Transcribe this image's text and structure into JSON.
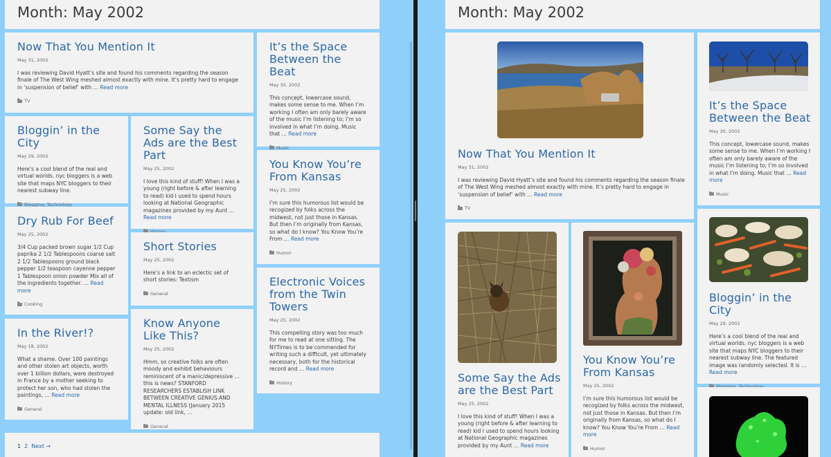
{
  "archive_title": "Month: May 2002",
  "read_more": "Read more",
  "left": {
    "posts": [
      {
        "title": "Now That You Mention It",
        "date": "May 31, 2002",
        "excerpt": "I was reviewing David Hyatt’s site and found his comments regarding the season finale of The West Wing meshed almost exactly with mine. It’s pretty hard to engage in ‘suspension of belief’ with …",
        "category": "TV"
      },
      {
        "title": "It’s the Space Between the Beat",
        "date": "May 30, 2002",
        "excerpt": "This concept, lowercase sound, makes some sense to me. When I’m working I often am only barely aware of the music I’m listening to; I’m so involved in what I’m doing. Music that …",
        "category": "Music"
      },
      {
        "title": "Bloggin’ in the City",
        "date": "May 29, 2002",
        "excerpt": "Here’s a cool blend of the real and virtual worlds. nyc bloggers is a web site that maps NYC bloggers to their nearest subway line.",
        "category": "Blogging, Technology"
      },
      {
        "title": "Some Say the Ads are the Best Part",
        "date": "May 25, 2002",
        "excerpt": "I love this kind of stuff! When I was a young (right before & after learning to read) kid I used to spend hours looking at National Geographic magazines provided by my Aunt …",
        "category": "History"
      },
      {
        "title": "You Know You’re From Kansas",
        "date": "May 25, 2002",
        "excerpt": "I’m sure this humorous list would be recogized by folks across the midwest, not just those in Kansas. But then I’m originally from Kansas, so what do I know? You Know You’re From …",
        "category": "Humor"
      },
      {
        "title": "Dry Rub For Beef",
        "date": "May 25, 2002",
        "excerpt": "3/4 Cup packed brown sugar 1/2 Cup paprika 2 1/2 Tablespoons coarse salt 2 1/2 Tablespoons ground black pepper 1/2 teaspoon cayenne pepper 1 Tablespoon onion powder Mix all of the ingredients together. …",
        "category": "Cooking"
      },
      {
        "title": "Short Stories",
        "date": "May 25, 2002",
        "excerpt": "Here’s a link to an eclectic set of short stories: Textism",
        "category": "General"
      },
      {
        "title": "Electronic Voices from the Twin Towers",
        "date": "May 25, 2002",
        "excerpt": "This compelling story was too much for me to read at one sitting. The NYTimes is to be commended for writing such a difficult, yet ultimately necessary, both for the historical record and …",
        "category": "History"
      },
      {
        "title": "In the River!?",
        "date": "May 18, 2002",
        "excerpt": "What a shame. Over 100 paintings and other stolen art objects, worth over 1 billion dollars, were destroyed in France by a mother seeking to protect her son, who had stolen the paintings, …",
        "category": "General"
      },
      {
        "title": "Know Anyone Like This?",
        "date": "May 25, 2002",
        "excerpt": "Hmm, so creative folks are often moody and exhibit behaviours reminiscent of a manic/depressive … this is news? STANFORD RESEARCHERS ESTABLISH LINK BETWEEN CREATIVE GENIUS AND MENTAL ILLNESS (January 2015 update: old link, …",
        "category": "General"
      }
    ],
    "pagination": {
      "current": "1",
      "page2": "2",
      "next": "Next →"
    }
  },
  "right": {
    "posts": [
      {
        "title": "Now That You Mention It",
        "date": "May 31, 2002",
        "excerpt": "I was reviewing David Hyatt’s site and found his comments regarding the season finale of The West Wing meshed almost exactly with mine. It’s pretty hard to engage in ‘suspension of belief’ with …",
        "category": "TV",
        "image": "lake-landscape-photo"
      },
      {
        "title": "It’s the Space Between the Beat",
        "date": "May 30, 2002",
        "excerpt": "This concept, lowercase sound, makes some sense to me. When I’m working I often am only barely aware of the music I’m listening to; I’m so involved in what I’m doing. Music that …",
        "category": "Music",
        "image": "winter-trees-photo"
      },
      {
        "title": "Some Say the Ads are the Best Part",
        "date": "May 25, 2002",
        "excerpt": "I love this kind of stuff! When I was a young (right before & after learning to read) kid I used to spend hours looking at National Geographic magazines provided by my Aunt …",
        "category": "History",
        "image": "dog-in-grass-photo"
      },
      {
        "title": "You Know You’re From Kansas",
        "date": "May 25, 2002",
        "excerpt": "I’m sure this humorous list would be recogized by folks across the midwest, not just those in Kansas. But then I’m originally from Kansas, so what do I know? You Know You’re From …",
        "category": "Humor",
        "image": "arcimboldo-painting"
      },
      {
        "title": "Bloggin’ in the City",
        "date": "May 29, 2002",
        "excerpt": "Here’s a cool blend of the real and virtual worlds. nyc bloggers is a web site that maps NYC bloggers to their nearest subway line. The featured image was randomly selected. It is …",
        "category": "Blogging, Technology",
        "image": "vegetables-photo"
      },
      {
        "image": "green-mineral-photo"
      }
    ]
  }
}
